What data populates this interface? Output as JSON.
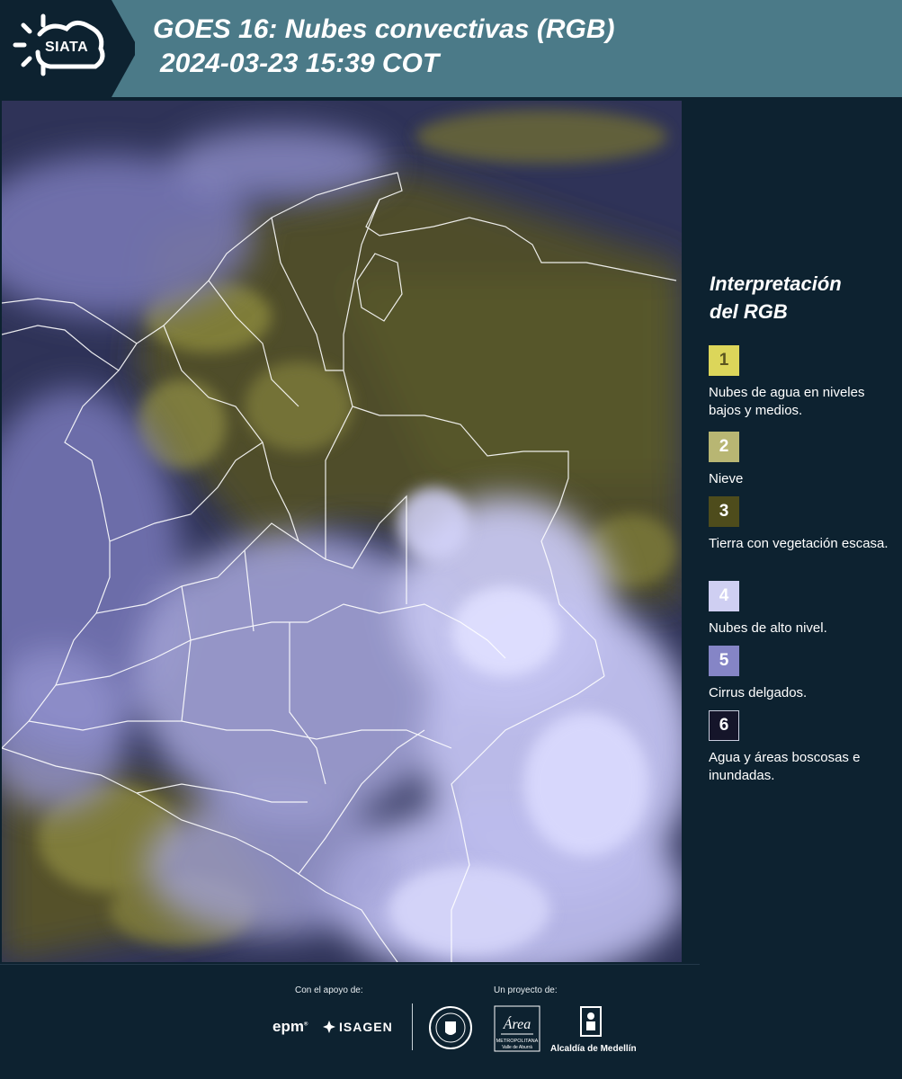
{
  "header": {
    "logo_text": "SIATA",
    "title_line1": "GOES 16: Nubes convectivas (RGB)",
    "title_line2": "2024-03-23 15:39 COT"
  },
  "map": {
    "kind": "satellite-rgb-composite",
    "region": "Colombia",
    "colors": {
      "ocean": "#2f3358",
      "land_low_clouds": "#5a5a2e",
      "high_clouds": "#c8c8f5",
      "border_lines": "#ffffff"
    }
  },
  "legend": {
    "title_line1": "Interpretación",
    "title_line2": "del RGB",
    "items": [
      {
        "number": "1",
        "label": "Nubes de agua en niveles bajos y medios.",
        "color": "#dcd65a",
        "text_color": "#5a5520"
      },
      {
        "number": "2",
        "label": "Nieve",
        "color": "#b8b673",
        "text_color": "#ffffff"
      },
      {
        "number": "3",
        "label": "Tierra con vegetación escasa.",
        "color": "#4e4c1c",
        "text_color": "#ffffff"
      },
      {
        "number": "4",
        "label": "Nubes de alto nivel.",
        "color": "#cfcff2",
        "text_color": "#ffffff"
      },
      {
        "number": "5",
        "label": "Cirrus delgados.",
        "color": "#8585c6",
        "text_color": "#ffffff"
      },
      {
        "number": "6",
        "label": "Agua y áreas boscosas e inundadas.",
        "color": "#15152a",
        "text_color": "#ffffff"
      }
    ]
  },
  "footer": {
    "support_label": "Con el apoyo de:",
    "project_label": "Un proyecto de:",
    "sponsor1": "epm",
    "sponsor2": "ISAGEN",
    "project_logo2_text": "Área",
    "project_logo2_sub": "METROPOLITANA",
    "project_logo2_sub2": "Valle de Aburrá",
    "project_logo3_text": "Alcaldía de Medellín"
  }
}
